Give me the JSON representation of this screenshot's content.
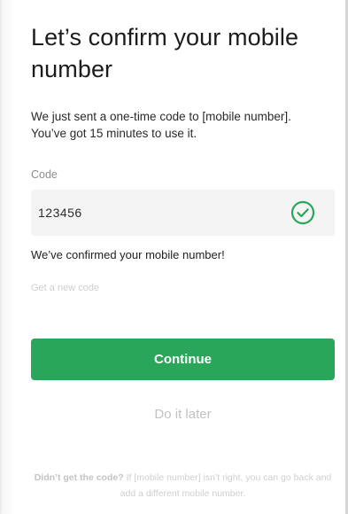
{
  "header": {
    "title": "Let’s confirm your mobile number"
  },
  "message": {
    "text": "We just sent a one-time code to [mobile number]. You’ve got 15 minutes to use it."
  },
  "code_field": {
    "label": "Code",
    "value": "123456",
    "status_icon": "check-circle-icon"
  },
  "status": {
    "confirmed_text": "We’ve confirmed your mobile number!"
  },
  "links": {
    "new_code": "Get a new code"
  },
  "actions": {
    "continue_label": "Continue",
    "later_label": "Do it later"
  },
  "footer": {
    "question": "Didn’t get the code?",
    "help_text": "If [mobile number] isn’t right, you can go back and add a different mobile number."
  },
  "colors": {
    "primary": "#2aa65a",
    "check": "#2aa65a",
    "field_bg": "#f4f4f4",
    "muted": "#cfcfcf"
  }
}
